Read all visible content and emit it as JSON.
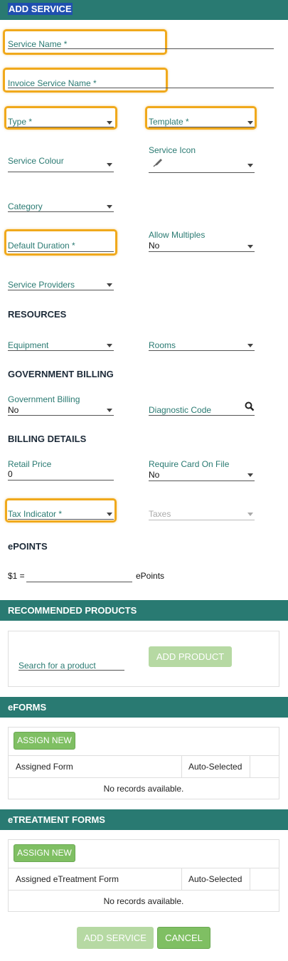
{
  "header": {
    "title": "ADD SERVICE"
  },
  "fields": {
    "service_name": "Service Name *",
    "invoice_service_name": "Invoice Service Name *",
    "type": "Type *",
    "template": "Template *",
    "service_colour": "Service Colour",
    "service_icon": "Service Icon",
    "category": "Category",
    "default_duration": "Default Duration *",
    "allow_multiples": {
      "label": "Allow Multiples",
      "value": "No"
    },
    "service_providers": "Service Providers"
  },
  "resources": {
    "heading": "RESOURCES",
    "equipment": "Equipment",
    "rooms": "Rooms"
  },
  "government_billing": {
    "heading": "GOVERNMENT BILLING",
    "billing": {
      "label": "Government Billing",
      "value": "No"
    },
    "diagnostic_code": "Diagnostic Code"
  },
  "billing_details": {
    "heading": "BILLING DETAILS",
    "retail_price": {
      "label": "Retail Price",
      "value": "0"
    },
    "require_card": {
      "label": "Require Card On File",
      "value": "No"
    },
    "tax_indicator": "Tax Indicator *",
    "taxes": "Taxes"
  },
  "epoints": {
    "heading": "ePOINTS",
    "prefix": "$1 =",
    "suffix": "ePoints"
  },
  "recommended": {
    "heading": "RECOMMENDED PRODUCTS",
    "search_placeholder": "Search for a product",
    "add_button": "ADD PRODUCT"
  },
  "eforms": {
    "heading": "eFORMS",
    "assign_button": "ASSIGN NEW",
    "col1": "Assigned Form",
    "col2": "Auto-Selected",
    "empty": "No records available."
  },
  "etreatment": {
    "heading": "eTREATMENT FORMS",
    "assign_button": "ASSIGN NEW",
    "col1": "Assigned eTreatment Form",
    "col2": "Auto-Selected",
    "empty": "No records available."
  },
  "footer": {
    "add_service": "ADD SERVICE",
    "cancel": "CANCEL"
  },
  "colors": {
    "teal": "#297a72",
    "highlight": "#f0a91c",
    "green": "#7fbf63"
  },
  "icons": [
    "pen-icon",
    "search-icon",
    "chevron-down-icon"
  ]
}
